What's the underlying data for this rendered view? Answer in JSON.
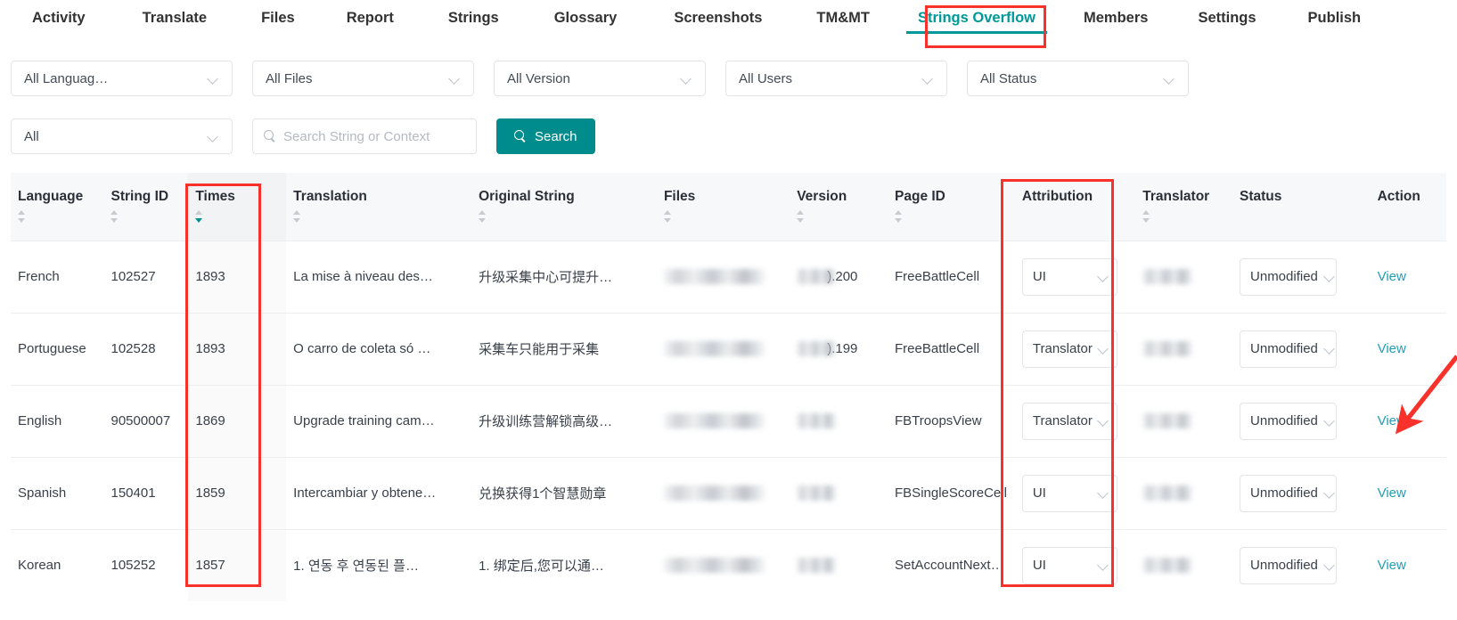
{
  "nav": {
    "tabs": [
      {
        "label": "Activity",
        "active": false
      },
      {
        "label": "Translate",
        "active": false
      },
      {
        "label": "Files",
        "active": false
      },
      {
        "label": "Report",
        "active": false
      },
      {
        "label": "Strings",
        "active": false
      },
      {
        "label": "Glossary",
        "active": false
      },
      {
        "label": "Screenshots",
        "active": false
      },
      {
        "label": "TM&MT",
        "active": false
      },
      {
        "label": "Strings Overflow",
        "active": true
      },
      {
        "label": "Members",
        "active": false
      },
      {
        "label": "Settings",
        "active": false
      },
      {
        "label": "Publish",
        "active": false
      }
    ]
  },
  "filters": {
    "language": "All Languag…",
    "files": "All Files",
    "version": "All Version",
    "users": "All Users",
    "status": "All Status",
    "scope": "All",
    "search_placeholder": "Search String or Context",
    "search_value": "",
    "search_button": "Search"
  },
  "table": {
    "columns": [
      {
        "key": "language",
        "label": "Language",
        "sortable": true,
        "sort": "none"
      },
      {
        "key": "string_id",
        "label": "String ID",
        "sortable": true,
        "sort": "none"
      },
      {
        "key": "times",
        "label": "Times",
        "sortable": true,
        "sort": "desc"
      },
      {
        "key": "translation",
        "label": "Translation",
        "sortable": true,
        "sort": "none"
      },
      {
        "key": "original",
        "label": "Original String",
        "sortable": true,
        "sort": "none"
      },
      {
        "key": "files",
        "label": "Files",
        "sortable": true,
        "sort": "none"
      },
      {
        "key": "version",
        "label": "Version",
        "sortable": true,
        "sort": "none"
      },
      {
        "key": "page_id",
        "label": "Page ID",
        "sortable": true,
        "sort": "none"
      },
      {
        "key": "attribution",
        "label": "Attribution",
        "sortable": false,
        "sort": "none"
      },
      {
        "key": "translator",
        "label": "Translator",
        "sortable": true,
        "sort": "none"
      },
      {
        "key": "status",
        "label": "Status",
        "sortable": false,
        "sort": "none"
      },
      {
        "key": "action",
        "label": "Action",
        "sortable": false,
        "sort": "none"
      }
    ],
    "rows": [
      {
        "language": "French",
        "string_id": "102527",
        "times": "1893",
        "translation": "La mise à niveau des…",
        "original": "升级采集中心可提升…",
        "files": "",
        "version": ").200",
        "page_id": "FreeBattleCell",
        "attribution": "UI",
        "translator": "",
        "status": "Unmodified",
        "action": "View"
      },
      {
        "language": "Portuguese",
        "string_id": "102528",
        "times": "1893",
        "translation": "O carro de coleta só …",
        "original": "采集车只能用于采集",
        "files": "",
        "version": ").199",
        "page_id": "FreeBattleCell",
        "attribution": "Translator",
        "translator": "",
        "status": "Unmodified",
        "action": "View"
      },
      {
        "language": "English",
        "string_id": "90500007",
        "times": "1869",
        "translation": "Upgrade training cam…",
        "original": "升级训练营解锁高级…",
        "files": "",
        "version": "",
        "page_id": "FBTroopsView",
        "attribution": "Translator",
        "translator": "",
        "status": "Unmodified",
        "action": "View"
      },
      {
        "language": "Spanish",
        "string_id": "150401",
        "times": "1859",
        "translation": "Intercambiar y obtene…",
        "original": "兑换获得1个智慧勋章",
        "files": "",
        "version": "",
        "page_id": "FBSingleScoreCell",
        "attribution": "UI",
        "translator": "",
        "status": "Unmodified",
        "action": "View"
      },
      {
        "language": "Korean",
        "string_id": "105252",
        "times": "1857",
        "translation": "1. 연동 후 연동된 플…",
        "original": "1. 绑定后,您可以通…",
        "files": "",
        "version": "",
        "page_id": "SetAccountNext…",
        "attribution": "UI",
        "translator": "",
        "status": "Unmodified",
        "action": "View"
      }
    ]
  },
  "colors": {
    "accent_teal": "#008c8c",
    "link_teal": "#1f9fb5",
    "annotation_red": "#f8312a",
    "header_bg": "#f7f8f9",
    "sorted_col_bg": "#fafafa"
  },
  "annotations": {
    "tab_highlight": "Strings Overflow",
    "times_column_highlight": "Times",
    "attribution_column_highlight": "Attribution",
    "arrow_target": "View"
  }
}
